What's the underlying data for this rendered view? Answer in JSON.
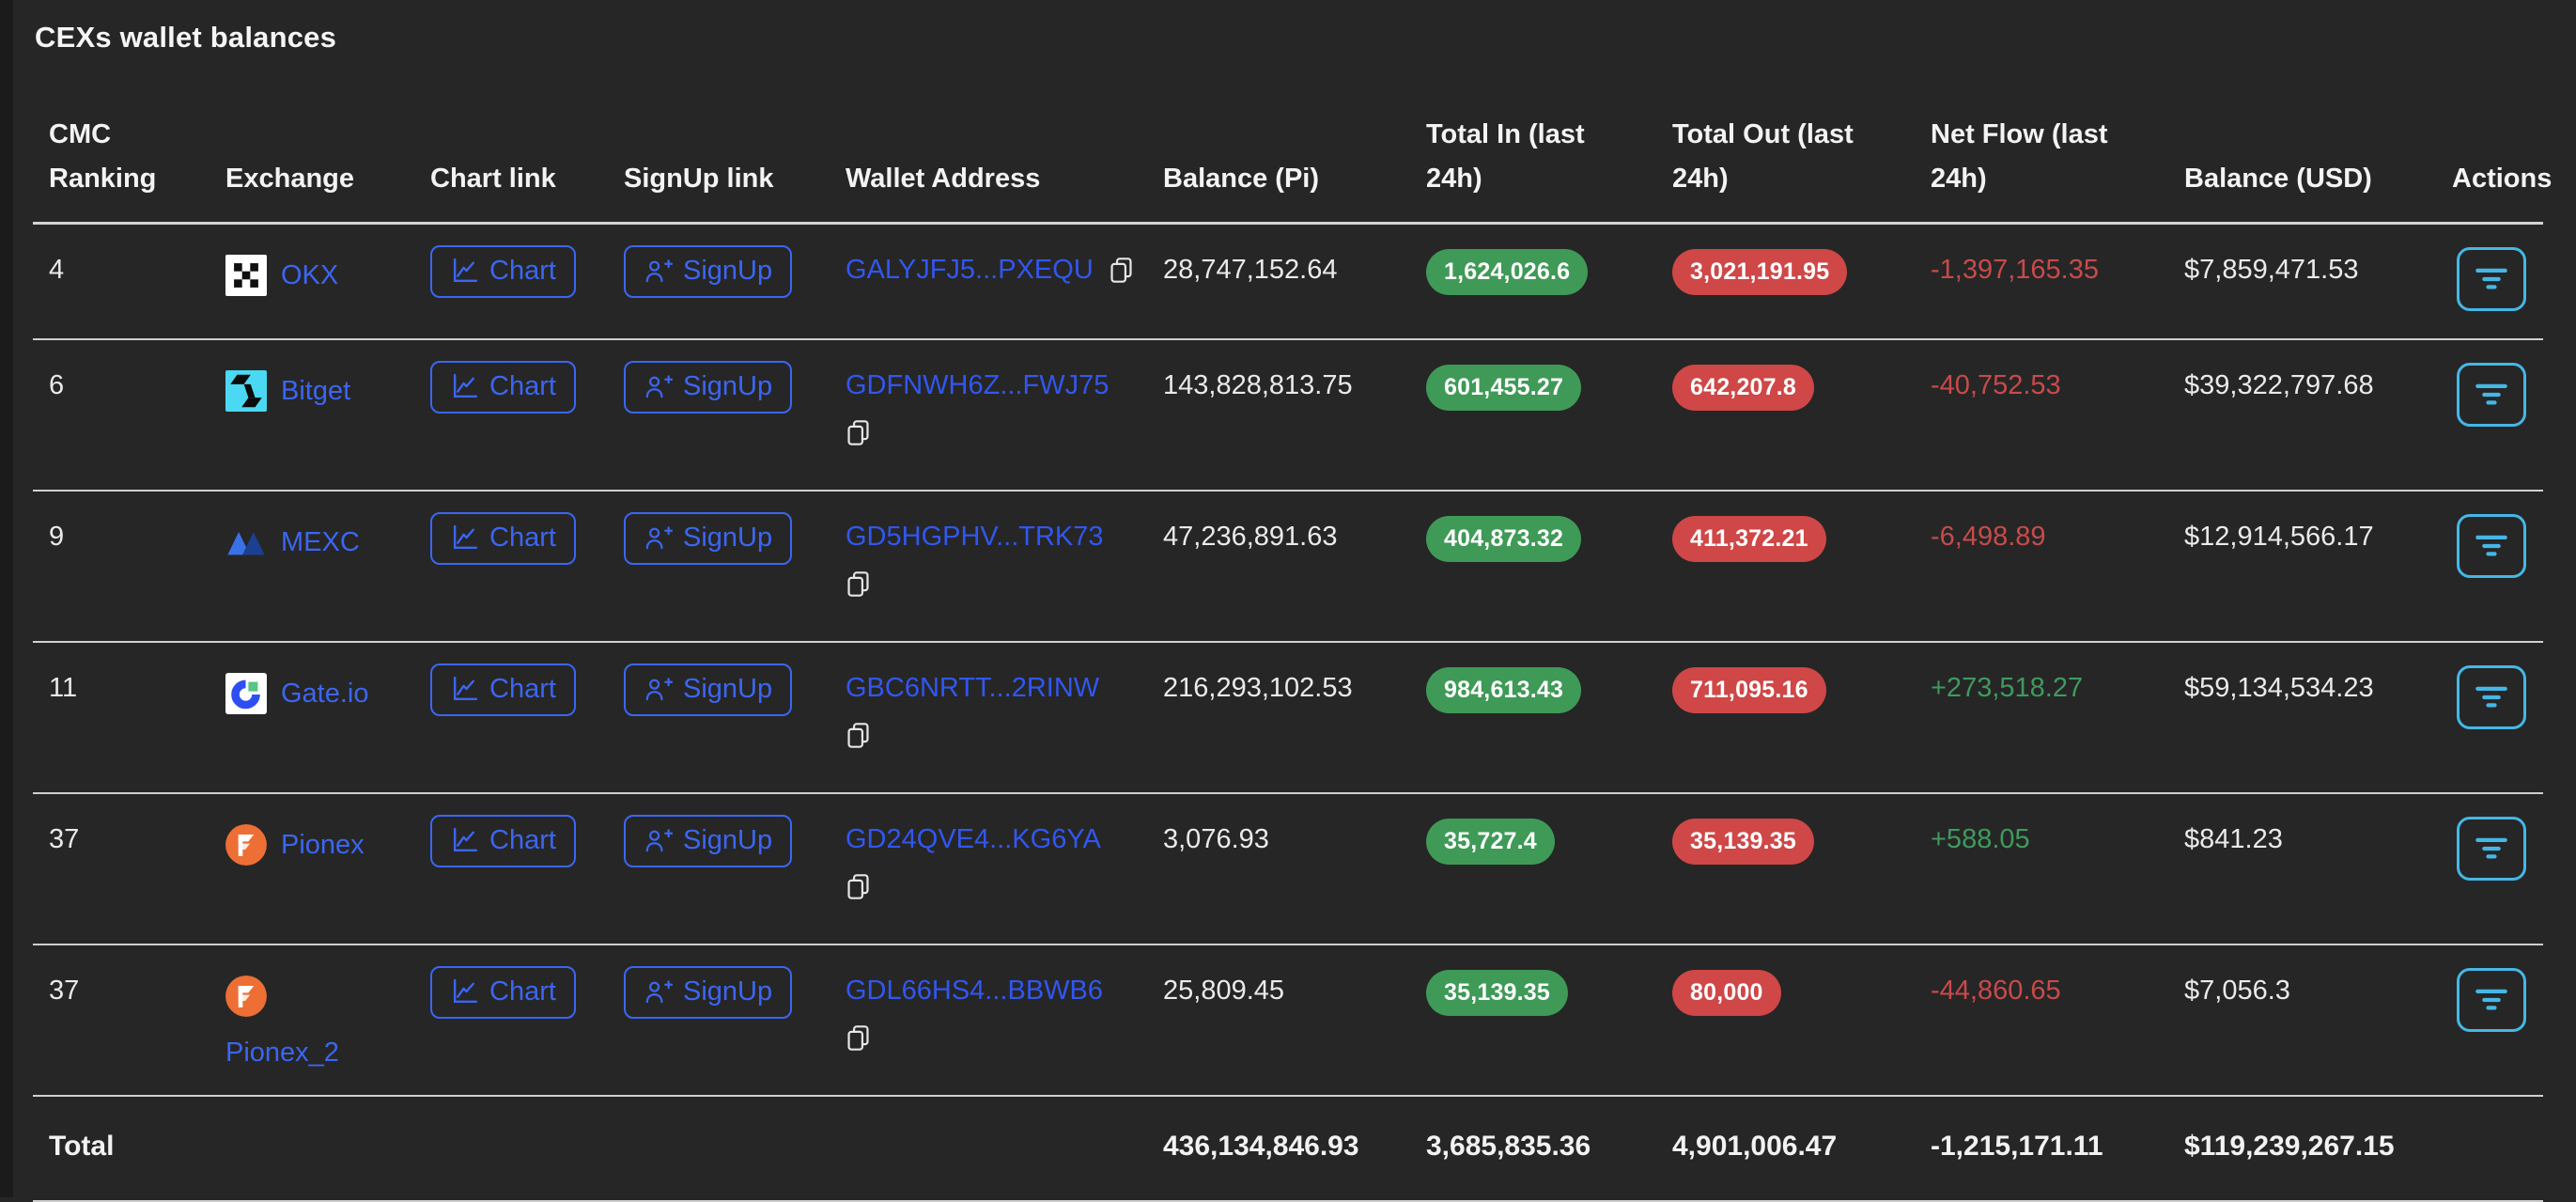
{
  "title": "CEXs wallet balances",
  "labels": {
    "chart": "Chart",
    "signup": "SignUp"
  },
  "colors": {
    "background": "#262626",
    "link_blue": "#3b66f2",
    "address_blue": "#3157f0",
    "badge_green": "#3f9a57",
    "badge_red": "#cf4747",
    "netflow_positive": "#3f9a5e",
    "netflow_negative": "#c94a4a",
    "actions_cyan": "#45b7e6",
    "separator": "#cfcfcf"
  },
  "table": {
    "columns": [
      {
        "label": "CMC Ranking"
      },
      {
        "label": "Exchange"
      },
      {
        "label": "Chart link"
      },
      {
        "label": "SignUp link"
      },
      {
        "label": "Wallet Address"
      },
      {
        "label": "Balance (Pi)"
      },
      {
        "label": "Total In (last 24h)"
      },
      {
        "label": "Total Out (last 24h)"
      },
      {
        "label": "Net Flow (last 24h)"
      },
      {
        "label": "Balance (USD)"
      },
      {
        "label": "Actions"
      }
    ],
    "rows": [
      {
        "rank": "4",
        "exchange": "OKX",
        "icon": "okx-icon",
        "address": "GALYJFJ5...PXEQU",
        "balance_pi": "28,747,152.64",
        "total_in": "1,624,026.6",
        "total_out": "3,021,191.95",
        "net_flow": "-1,397,165.35",
        "net_dir": "neg",
        "balance_usd": "$7,859,471.53"
      },
      {
        "rank": "6",
        "exchange": "Bitget",
        "icon": "bitget-icon",
        "address": "GDFNWH6Z...FWJ75",
        "balance_pi": "143,828,813.75",
        "total_in": "601,455.27",
        "total_out": "642,207.8",
        "net_flow": "-40,752.53",
        "net_dir": "neg",
        "balance_usd": "$39,322,797.68"
      },
      {
        "rank": "9",
        "exchange": "MEXC",
        "icon": "mexc-icon",
        "address": "GD5HGPHV...TRK73",
        "balance_pi": "47,236,891.63",
        "total_in": "404,873.32",
        "total_out": "411,372.21",
        "net_flow": "-6,498.89",
        "net_dir": "neg",
        "balance_usd": "$12,914,566.17"
      },
      {
        "rank": "11",
        "exchange": "Gate.io",
        "icon": "gateio-icon",
        "address": "GBC6NRTT...2RINW",
        "balance_pi": "216,293,102.53",
        "total_in": "984,613.43",
        "total_out": "711,095.16",
        "net_flow": "+273,518.27",
        "net_dir": "pos",
        "balance_usd": "$59,134,534.23"
      },
      {
        "rank": "37",
        "exchange": "Pionex",
        "icon": "pionex-icon",
        "address": "GD24QVE4...KG6YA",
        "balance_pi": "3,076.93",
        "total_in": "35,727.4",
        "total_out": "35,139.35",
        "net_flow": "+588.05",
        "net_dir": "pos",
        "balance_usd": "$841.23"
      },
      {
        "rank": "37",
        "exchange": "Pionex_2",
        "icon": "pionex-icon",
        "address": "GDL66HS4...BBWB6",
        "balance_pi": "25,809.45",
        "total_in": "35,139.35",
        "total_out": "80,000",
        "net_flow": "-44,860.65",
        "net_dir": "neg",
        "balance_usd": "$7,056.3"
      }
    ],
    "total": {
      "label": "Total",
      "balance_pi": "436,134,846.93",
      "total_in": "3,685,835.36",
      "total_out": "4,901,006.47",
      "net_flow": "-1,215,171.11",
      "balance_usd": "$119,239,267.15"
    }
  }
}
